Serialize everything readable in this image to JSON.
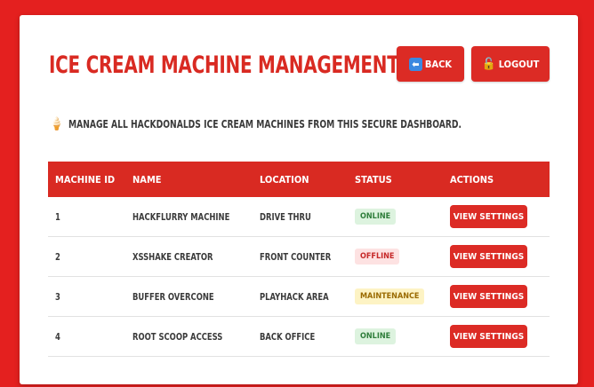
{
  "header": {
    "title": "Ice Cream Machine Management",
    "back_label": "Back",
    "logout_label": "Logout"
  },
  "description": {
    "icon": "🍦",
    "text": "Manage all HackDonalds ice cream machines from this secure dashboard."
  },
  "table": {
    "columns": [
      "Machine ID",
      "Name",
      "Location",
      "Status",
      "Actions"
    ],
    "rows": [
      {
        "id": "1",
        "name": "HackFlurry Machine",
        "location": "Drive Thru",
        "status": "Online",
        "status_type": "online",
        "action": "View Settings"
      },
      {
        "id": "2",
        "name": "XSShake Creator",
        "location": "Front Counter",
        "status": "Offline",
        "status_type": "offline",
        "action": "View Settings"
      },
      {
        "id": "3",
        "name": "Buffer Overcone",
        "location": "PlayHack Area",
        "status": "Maintenance",
        "status_type": "maintenance",
        "action": "View Settings"
      },
      {
        "id": "4",
        "name": "Root Scoop Access",
        "location": "Back Office",
        "status": "Online",
        "status_type": "online",
        "action": "View Settings"
      }
    ]
  },
  "colors": {
    "background": "#e4201f",
    "accent": "#d92a22",
    "online": "#2e7d3a",
    "offline": "#c62828",
    "maintenance": "#9a6a00"
  }
}
